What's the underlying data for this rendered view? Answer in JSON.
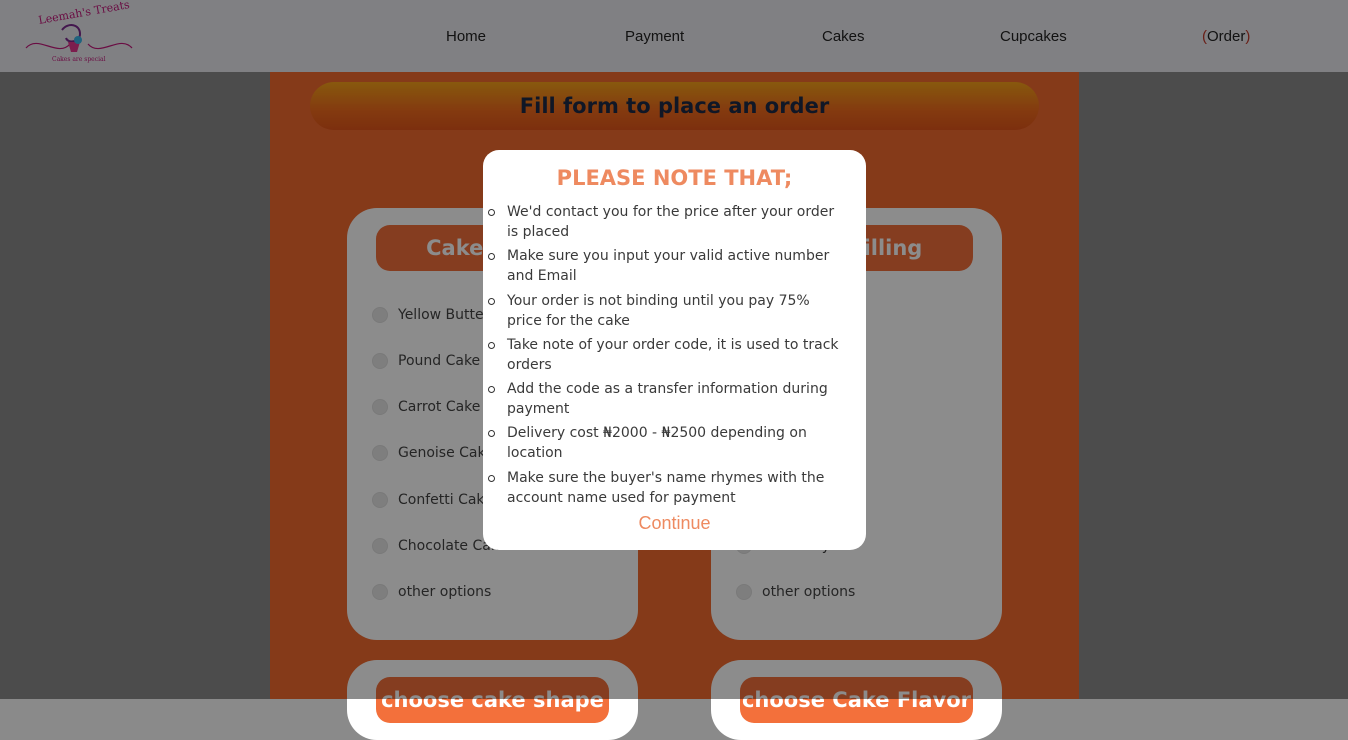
{
  "nav": {
    "logo_text": "Leemah's Treats",
    "logo_tagline": "Cakes are special",
    "links": [
      "Home",
      "Payment",
      "Cakes",
      "Cupcakes",
      "Order"
    ]
  },
  "form": {
    "title": "Fill form to place an order",
    "left_card": {
      "header": "Cake flavor",
      "options": [
        "Yellow Butter Cake",
        "Pound Cake",
        "Carrot Cake",
        "Genoise Cake",
        "Confetti Cake",
        "Chocolate Cake",
        "other options"
      ]
    },
    "right_card": {
      "header": "Cake filling",
      "options": [
        "Blueberry",
        "other options"
      ]
    },
    "bottom_left_header": "choose cake shape",
    "bottom_right_header": "choose Cake Flavor"
  },
  "modal": {
    "title": "PLEASE NOTE THAT;",
    "items": [
      "We'd contact you for the price after your order is placed",
      "Make sure you input your valid active number and Email",
      "Your order is not binding until you pay 75% price for the cake",
      "Take note of your order code, it is used to track orders",
      "Add the code as a transfer information during payment",
      "Delivery cost ₦2000 - ₦2500 depending on location",
      "Make sure the buyer's name rhymes with the account name used for payment"
    ],
    "continue_label": "Continue"
  },
  "colors": {
    "accent": "#f26a2e",
    "modal_accent": "#ee8a60"
  }
}
